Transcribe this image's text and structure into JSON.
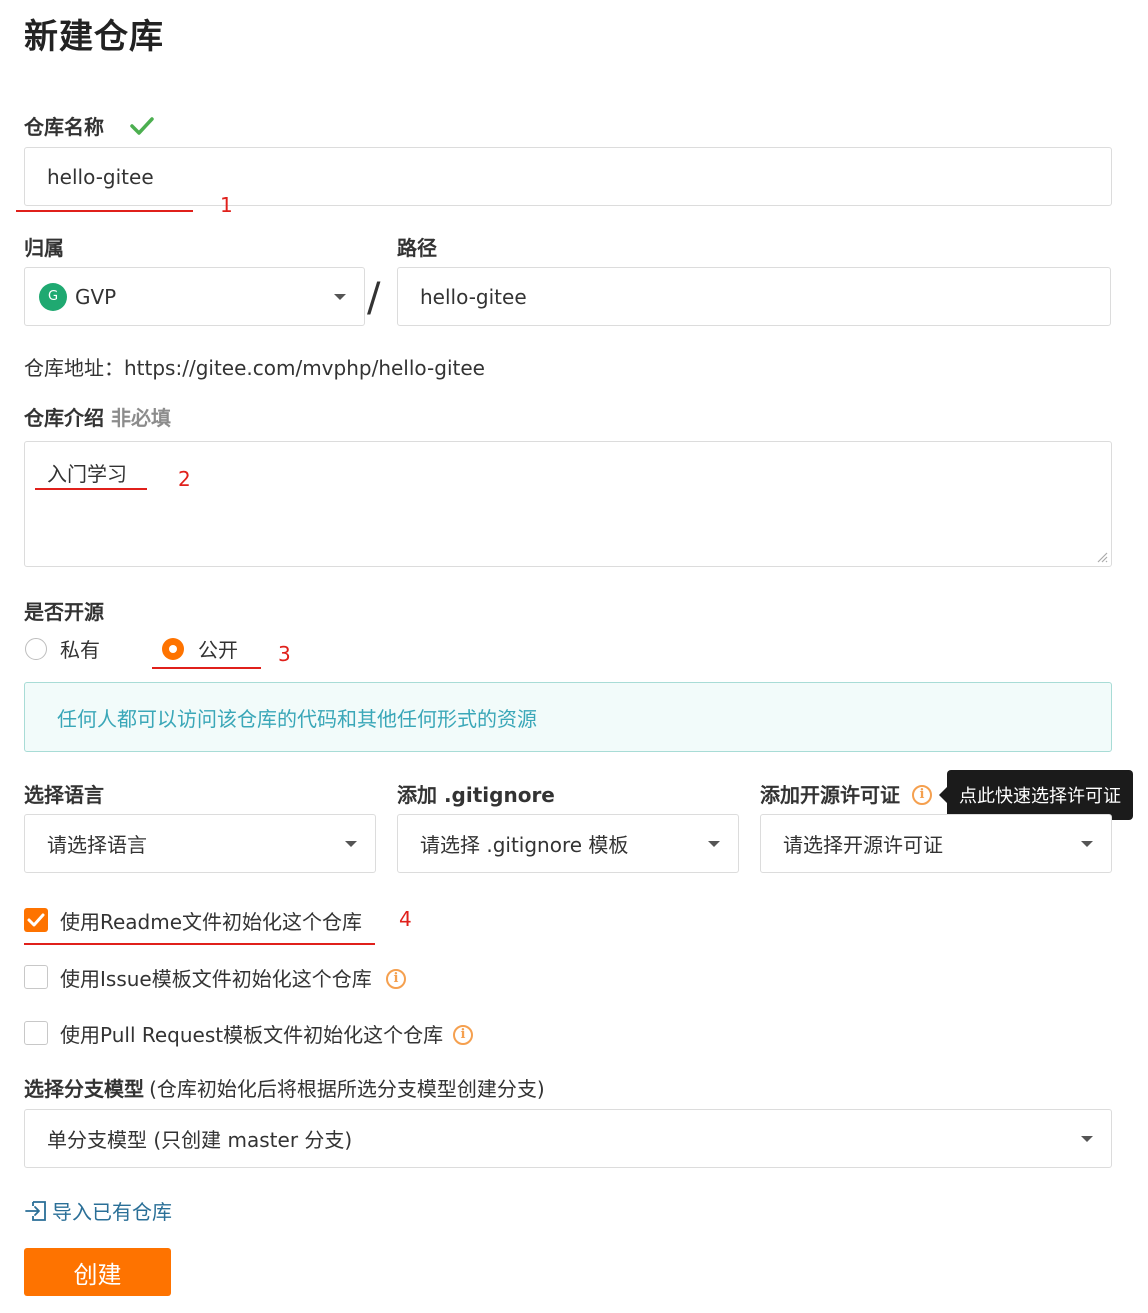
{
  "page_title": "新建仓库",
  "repo_name": {
    "label": "仓库名称",
    "status_icon": "check-icon",
    "value": "hello-gitee"
  },
  "owner": {
    "label": "归属",
    "avatar_letter": "G",
    "value": "GVP"
  },
  "separator": "/",
  "path": {
    "label": "路径",
    "value": "hello-gitee"
  },
  "repo_address": "仓库地址：https://gitee.com/mvphp/hello-gitee",
  "description": {
    "label": "仓库介绍",
    "optional_label": "非必填",
    "value": "入门学习"
  },
  "visibility": {
    "label": "是否开源",
    "options": [
      "私有",
      "公开"
    ],
    "selected": "公开",
    "notice": "任何人都可以访问该仓库的代码和其他任何形式的资源"
  },
  "language": {
    "label": "选择语言",
    "placeholder": "请选择语言"
  },
  "gitignore": {
    "label": "添加 .gitignore",
    "placeholder": "请选择 .gitignore 模板"
  },
  "license": {
    "label": "添加开源许可证",
    "placeholder": "请选择开源许可证",
    "tooltip": "点此快速选择许可证"
  },
  "init_options": [
    {
      "label": "使用Readme文件初始化这个仓库",
      "checked": true
    },
    {
      "label": "使用Issue模板文件初始化这个仓库",
      "checked": false
    },
    {
      "label": "使用Pull Request模板文件初始化这个仓库",
      "checked": false
    }
  ],
  "branch_model": {
    "label": "选择分支模型",
    "hint": "(仓库初始化后将根据所选分支模型创建分支)",
    "value": "单分支模型 (只创建 master 分支)"
  },
  "import_link": "导入已有仓库",
  "create_button": "创建",
  "annotations": [
    "1",
    "2",
    "3",
    "4"
  ],
  "colors": {
    "accent": "#fe7300",
    "success": "#4caf50",
    "annotation": "#e0201b",
    "notice_text": "#3aa7b8",
    "link": "#2a6f97"
  }
}
